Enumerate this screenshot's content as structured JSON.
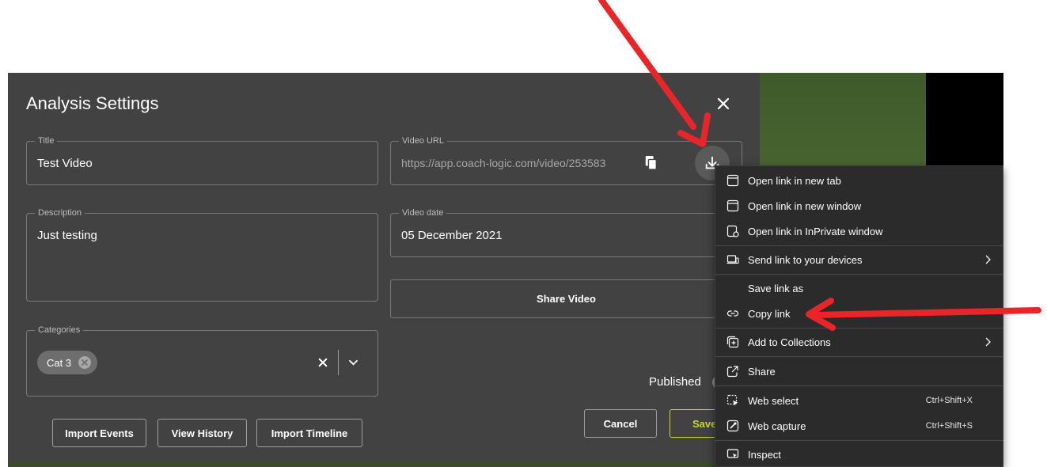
{
  "dialog": {
    "title": "Analysis Settings",
    "fields": {
      "title": {
        "label": "Title",
        "value": "Test Video"
      },
      "description": {
        "label": "Description",
        "value": "Just testing"
      },
      "categories": {
        "label": "Categories",
        "chip": "Cat 3"
      },
      "video_url": {
        "label": "Video URL",
        "value": "https://app.coach-logic.com/video/253583"
      },
      "video_date": {
        "label": "Video date",
        "value": "05 December 2021"
      }
    },
    "share_button": "Share Video",
    "published_label": "Published",
    "cancel_button": "Cancel",
    "save_button": "Save",
    "footer_buttons": [
      "Import Events",
      "View History",
      "Import Timeline"
    ]
  },
  "context_menu": {
    "items": [
      {
        "label": "Open link in new tab",
        "icon": "new-tab-icon"
      },
      {
        "label": "Open link in new window",
        "icon": "new-window-icon"
      },
      {
        "label": "Open link in InPrivate window",
        "icon": "inprivate-icon"
      },
      {
        "label": "Send link to your devices",
        "icon": "devices-icon"
      },
      {
        "label": "Save link as",
        "icon": ""
      },
      {
        "label": "Copy link",
        "icon": "link-icon"
      },
      {
        "label": "Add to Collections",
        "icon": "collections-icon"
      },
      {
        "label": "Share",
        "icon": "share-icon"
      },
      {
        "label": "Web select",
        "icon": "web-select-icon",
        "shortcut": "Ctrl+Shift+X"
      },
      {
        "label": "Web capture",
        "icon": "web-capture-icon",
        "shortcut": "Ctrl+Shift+S"
      },
      {
        "label": "Inspect",
        "icon": "inspect-icon"
      }
    ]
  },
  "colors": {
    "arrow": "#e8262a",
    "save_accent": "#c6d92a",
    "dialog_bg": "#424242",
    "menu_bg": "#2b2b2b"
  }
}
